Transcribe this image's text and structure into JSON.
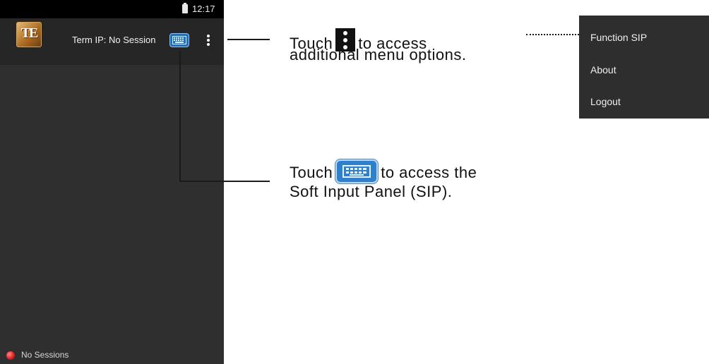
{
  "status_bar": {
    "time": "12:17"
  },
  "app_bar": {
    "logo_text": "TE",
    "term_ip": "Term IP: No Session"
  },
  "footer": {
    "status": "No Sessions"
  },
  "callouts": {
    "menu": {
      "pre": "Touch",
      "post": "to access",
      "line2": "additional menu options."
    },
    "sip": {
      "pre": "Touch",
      "post": "to access the",
      "line2": "Soft Input Panel (SIP)."
    }
  },
  "overflow_menu": {
    "items": [
      "Function SIP",
      "About",
      "Logout"
    ]
  }
}
